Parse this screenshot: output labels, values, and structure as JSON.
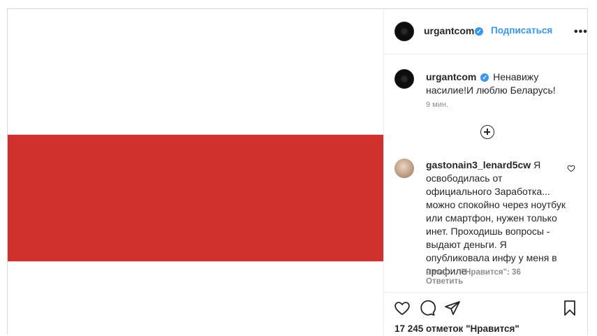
{
  "post": {
    "username": "urgantcom",
    "follow_label": "Подписаться",
    "caption": "Ненавижу насилие!И люблю Беларусь!",
    "caption_time": "9 мин.",
    "likes": "17 245 отметок \"Нравится\""
  },
  "comment": {
    "username": "gastonain3_lenard5cw",
    "text": "Я освободилась от официального Заработка... можно спокойно через ноутбук или смартфон, нужен только инет. Проходишь вопросы - выдают деньги. Я опубликовала инфу у меня в профиле",
    "time": "9 мин.",
    "likes": "\"Нравится\": 36",
    "reply_label": "Ответить"
  },
  "icons": {
    "verified": "verified-badge-icon",
    "more": "more-options-icon",
    "add": "load-more-comments-icon",
    "like": "heart-icon",
    "comment": "comment-icon",
    "share": "share-icon",
    "save": "bookmark-icon"
  },
  "colors": {
    "accent": "#3897f0",
    "flag_red": "#d0312d",
    "flag_white": "#ffffff",
    "muted": "#8e8e8e"
  }
}
